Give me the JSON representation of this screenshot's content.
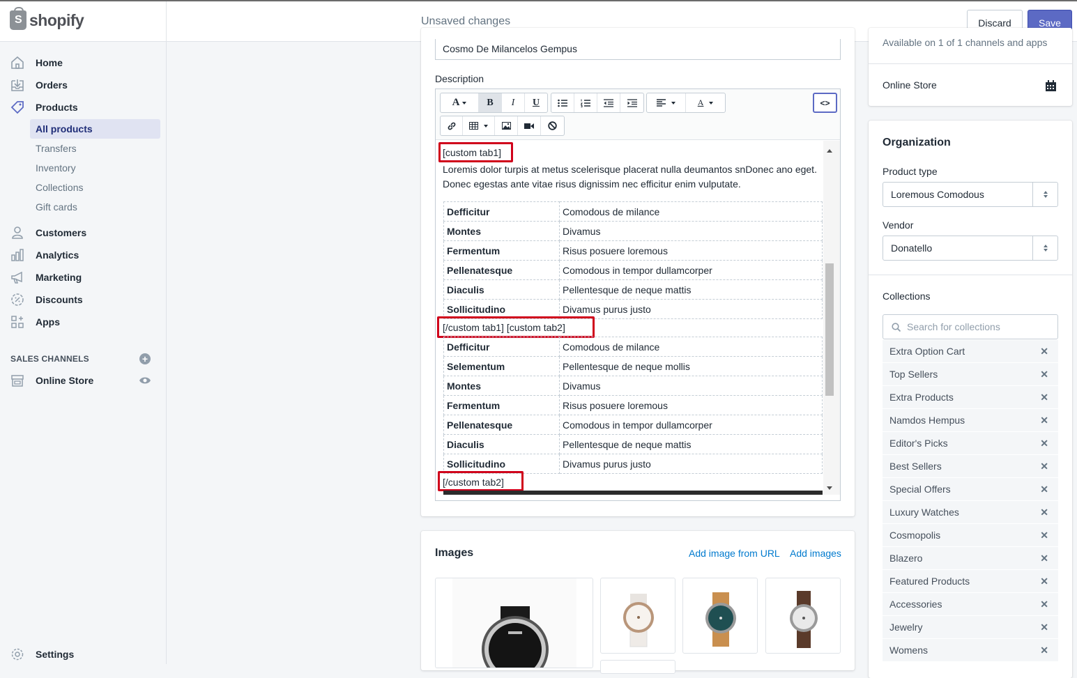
{
  "app": {
    "logo": "shopify",
    "logo_mark": "S"
  },
  "topbar": {
    "status": "Unsaved changes",
    "discard": "Discard",
    "save": "Save"
  },
  "sidebar": {
    "items": [
      {
        "label": "Home",
        "icon": "home-icon"
      },
      {
        "label": "Orders",
        "icon": "orders-icon"
      },
      {
        "label": "Products",
        "icon": "tag-icon"
      },
      {
        "label": "Customers",
        "icon": "person-icon"
      },
      {
        "label": "Analytics",
        "icon": "bar-chart-icon"
      },
      {
        "label": "Marketing",
        "icon": "megaphone-icon"
      },
      {
        "label": "Discounts",
        "icon": "discount-icon"
      },
      {
        "label": "Apps",
        "icon": "apps-icon"
      }
    ],
    "product_sub": [
      "All products",
      "Transfers",
      "Inventory",
      "Collections",
      "Gift cards"
    ],
    "sales_channels_heading": "SALES CHANNELS",
    "online_store": "Online Store",
    "settings": "Settings"
  },
  "product": {
    "title_value": "Cosmo De Milancelos Gempus",
    "description_label": "Description"
  },
  "editor": {
    "code_toggle": "<>",
    "shortcode_open1": "[custom tab1]",
    "paragraph": "Loremis dolor turpis at metus scelerisque placerat nulla deumantos snDonec ano eget. Donec egestas ante vitae risus dignissim nec efficitur enim vulputate.",
    "table1": [
      [
        "Defficitur",
        "Comodous de milance"
      ],
      [
        "Montes",
        "Divamus"
      ],
      [
        "Fermentum",
        "Risus posuere loremous"
      ],
      [
        "Pellenatesque",
        "Comodous in tempor dullamcorper"
      ],
      [
        "Diaculis",
        "Pellentesque de neque mattis"
      ],
      [
        "Sollicitudino",
        "Divamus purus justo"
      ]
    ],
    "shortcode_mid": "[/custom tab1] [custom tab2]",
    "table2": [
      [
        "Defficitur",
        "Comodous de milance"
      ],
      [
        "Selementum",
        "Pellentesque de neque mollis"
      ],
      [
        "Montes",
        "Divamus"
      ],
      [
        "Fermentum",
        "Risus posuere loremous"
      ],
      [
        "Pellenatesque",
        "Comodous in tempor dullamcorper"
      ],
      [
        "Diaculis",
        "Pellentesque de neque mattis"
      ],
      [
        "Sollicitudino",
        "Divamus purus justo"
      ]
    ],
    "shortcode_close2": "[/custom tab2]"
  },
  "images": {
    "title": "Images",
    "add_url": "Add image from URL",
    "add_images": "Add images"
  },
  "availability": {
    "text": "Available on 1 of 1 channels and apps",
    "online_store": "Online Store"
  },
  "organization": {
    "title": "Organization",
    "product_type_label": "Product type",
    "product_type_value": "Loremous Comodous",
    "vendor_label": "Vendor",
    "vendor_value": "Donatello",
    "collections_label": "Collections",
    "collections_placeholder": "Search for collections",
    "collections": [
      "Extra Option Cart",
      "Top Sellers",
      "Extra Products",
      "Namdos Hempus",
      "Editor's Picks",
      "Best Sellers",
      "Special Offers",
      "Luxury Watches",
      "Cosmopolis",
      "Blazero",
      "Featured Products",
      "Accessories",
      "Jewelry",
      "Womens"
    ]
  },
  "colors": {
    "accent": "#5c6ac4",
    "link": "#007ace",
    "highlight_box": "#d0021b"
  }
}
